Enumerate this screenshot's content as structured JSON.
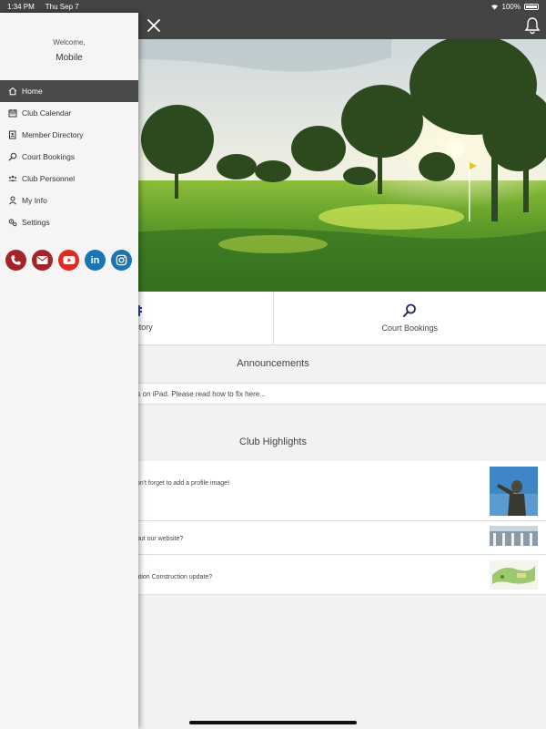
{
  "status_bar": {
    "time": "1:34 PM",
    "date": "Thu Sep 7",
    "battery": "100%"
  },
  "app_bar": {
    "close_icon": "close-icon",
    "bell_icon": "bell-icon"
  },
  "drawer": {
    "welcome": "Welcome,",
    "user_name": "Mobile",
    "menu": [
      {
        "label": "Home",
        "icon": "home-icon",
        "active": true
      },
      {
        "label": "Club Calendar",
        "icon": "calendar-icon"
      },
      {
        "label": "Member Directory",
        "icon": "directory-icon"
      },
      {
        "label": "Court Bookings",
        "icon": "racket-icon"
      },
      {
        "label": "Club Personnel",
        "icon": "people-icon"
      },
      {
        "label": "My Info",
        "icon": "user-icon"
      },
      {
        "label": "Settings",
        "icon": "gear-icon"
      }
    ],
    "social": [
      "phone-icon",
      "email-icon",
      "youtube-icon",
      "linkedin-icon",
      "instagram-icon"
    ],
    "linkedin_text": "in"
  },
  "quick_links": [
    {
      "label": "Directory",
      "icon": "directory-icon"
    },
    {
      "label": "Court Bookings",
      "icon": "racket-icon"
    }
  ],
  "announcements": {
    "title": "Announcements",
    "items": [
      "ns on iPad. Please read how to fix here..."
    ]
  },
  "highlights": {
    "title": "Club Highlights",
    "items": [
      {
        "text": "don't forget to add a profile image!"
      },
      {
        "text": "bout our website?"
      },
      {
        "text": "vation Construction update?"
      }
    ]
  },
  "colors": {
    "dark_bar": "#444444",
    "accent_red": "#a3232a",
    "accent_blue": "#1a74b5",
    "youtube_red": "#e02a20"
  }
}
